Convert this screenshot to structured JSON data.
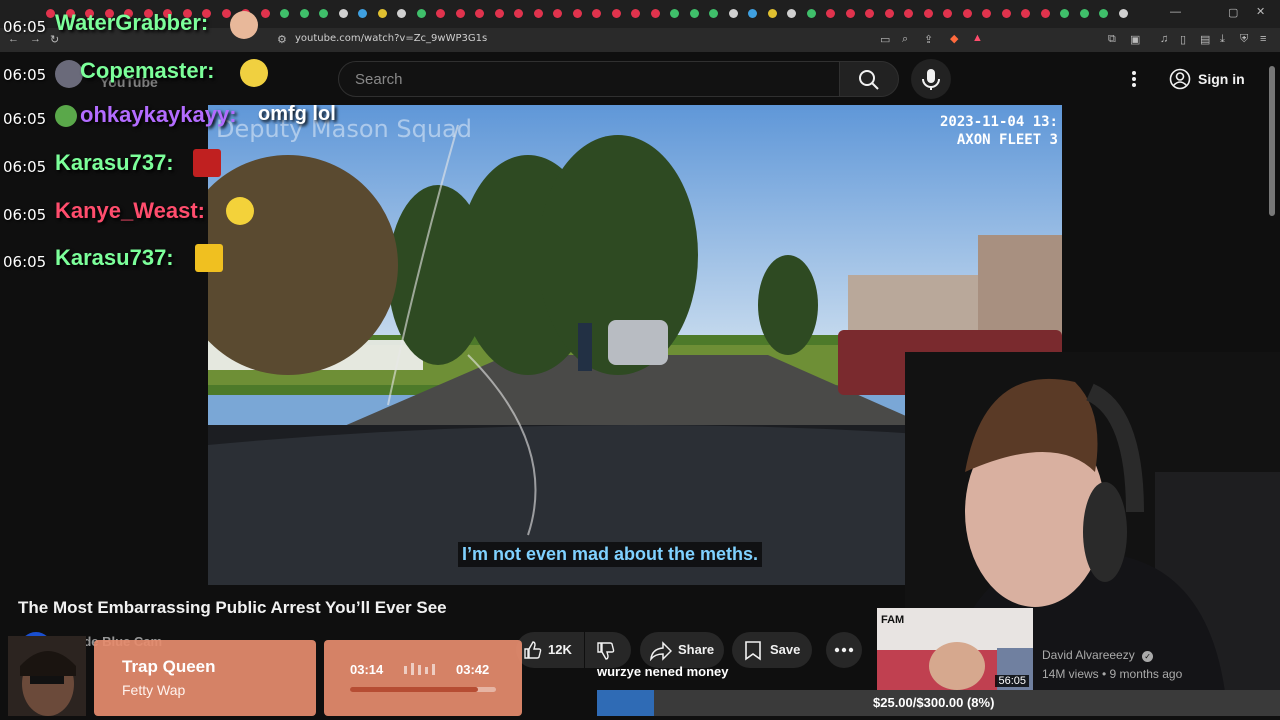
{
  "browser": {
    "url": "youtube.com/watch?v=Zc_9wWP3G1s"
  },
  "youtube": {
    "logo_text": "YouTube",
    "search_placeholder": "Search",
    "sign_in_label": "Sign in"
  },
  "video": {
    "caption": "I’m not even mad about the meths.",
    "overlay_title": "Deputy Mason Squad",
    "overlay_timestamp_line1": "2023-11-04 13:",
    "overlay_timestamp_line2": "AXON FLEET 3"
  },
  "under_video": {
    "title": "The Most Embarrassing Public Arrest You’ll Ever See",
    "channel_name": "Code Blue Cam",
    "like_count": "12K",
    "share_label": "Share",
    "save_label": "Save"
  },
  "chat": [
    {
      "time": "06:05",
      "name": "WaterGrabber:",
      "message": "",
      "color": "#7CFF9A"
    },
    {
      "time": "06:05",
      "name": "Copemaster:",
      "message": "",
      "color": "#7CFF9A"
    },
    {
      "time": "06:05",
      "name": "ohkaykaykayy:",
      "message": "omfg lol",
      "color": "#b36cff"
    },
    {
      "time": "06:05",
      "name": "Karasu737:",
      "message": "",
      "color": "#7CFF9A"
    },
    {
      "time": "06:05",
      "name": "Kanye_Weast:",
      "message": "",
      "color": "#ff4d6d"
    },
    {
      "time": "06:05",
      "name": "Karasu737:",
      "message": "",
      "color": "#7CFF9A"
    }
  ],
  "music": {
    "song": "Trap Queen",
    "artist": "Fetty Wap",
    "current_time": "03:14",
    "total_time": "03:42",
    "progress_fraction": 0.874
  },
  "recommendation": {
    "thumb_label": "FAM",
    "duration": "56:05",
    "channel": "David Alvareeezy",
    "meta": "14M views • 9 months ago"
  },
  "stream_overlay": {
    "donation_message": "wurzye nened money",
    "goal_text": "$25.00/$300.00 (8%)",
    "goal_fraction": 0.083
  },
  "colors": {
    "caption_text": "#7fd1ff",
    "music_box": "#e68c6e",
    "goal_fill": "#2f6bb5"
  }
}
